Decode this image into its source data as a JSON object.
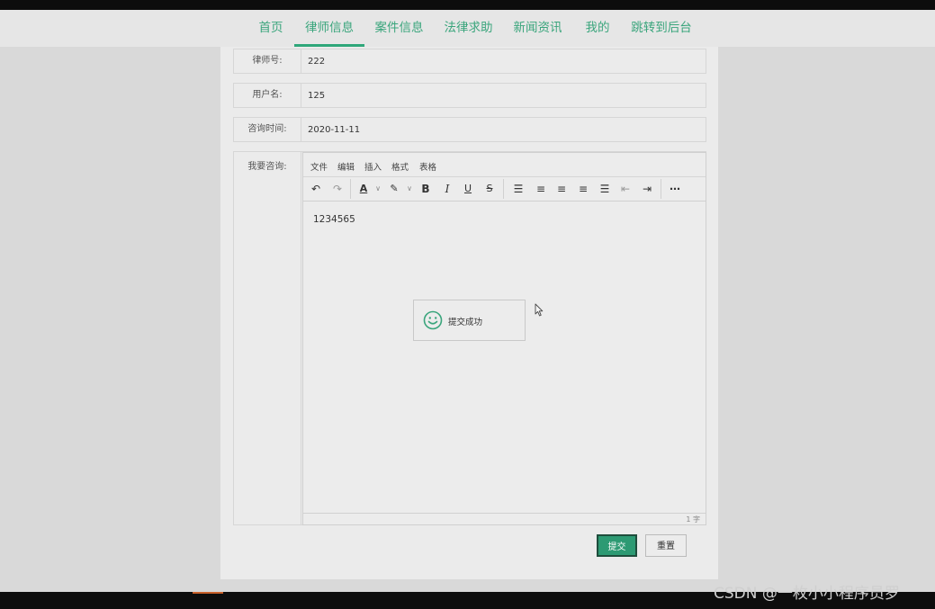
{
  "nav": {
    "items": [
      "首页",
      "律师信息",
      "案件信息",
      "法律求助",
      "新闻资讯",
      "我的",
      "跳转到后台"
    ],
    "active_index": 1
  },
  "form": {
    "lawyer_no": {
      "label": "律师号:",
      "value": "222"
    },
    "username": {
      "label": "用户名:",
      "value": "125"
    },
    "consult_time": {
      "label": "咨询时间:",
      "value": "2020-11-11"
    },
    "consult_content": {
      "label": "我要咨询:"
    }
  },
  "editor": {
    "menu": [
      "文件",
      "编辑",
      "插入",
      "格式",
      "表格"
    ],
    "content": "1234565",
    "word_count": "1 字"
  },
  "toast": {
    "message": "提交成功"
  },
  "buttons": {
    "submit": "提交",
    "reset": "重置"
  },
  "watermark": "CSDN @一枚小小程序员罗",
  "colors": {
    "accent": "#2fa77a",
    "submit_bg": "#2d9a73"
  }
}
